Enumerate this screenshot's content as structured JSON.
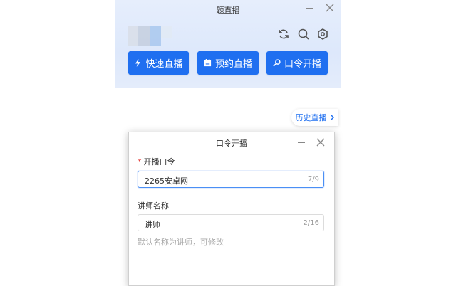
{
  "app": {
    "title": "题直播",
    "avatar_colors": [
      "#d9dfe9",
      "#c9d3e3",
      "#a9c8ef",
      "#d8e6f7",
      "#e7ecf3"
    ],
    "icons": [
      "refresh-icon",
      "search-icon",
      "settings-icon"
    ],
    "accent": "#1f6ff0",
    "buttons": {
      "quick": "快速直播",
      "schedule": "预约直播",
      "passcode": "口令开播"
    },
    "history": "历史直播"
  },
  "dialog": {
    "title": "口令开播",
    "passcode_label": "开播口令",
    "required_mark": "*",
    "passcode_value": "2265安卓网",
    "passcode_count": "7/9",
    "teacher_label": "讲师名称",
    "teacher_value": "讲师",
    "teacher_count": "2/16",
    "hint": "默认名称为讲师，可修改"
  }
}
